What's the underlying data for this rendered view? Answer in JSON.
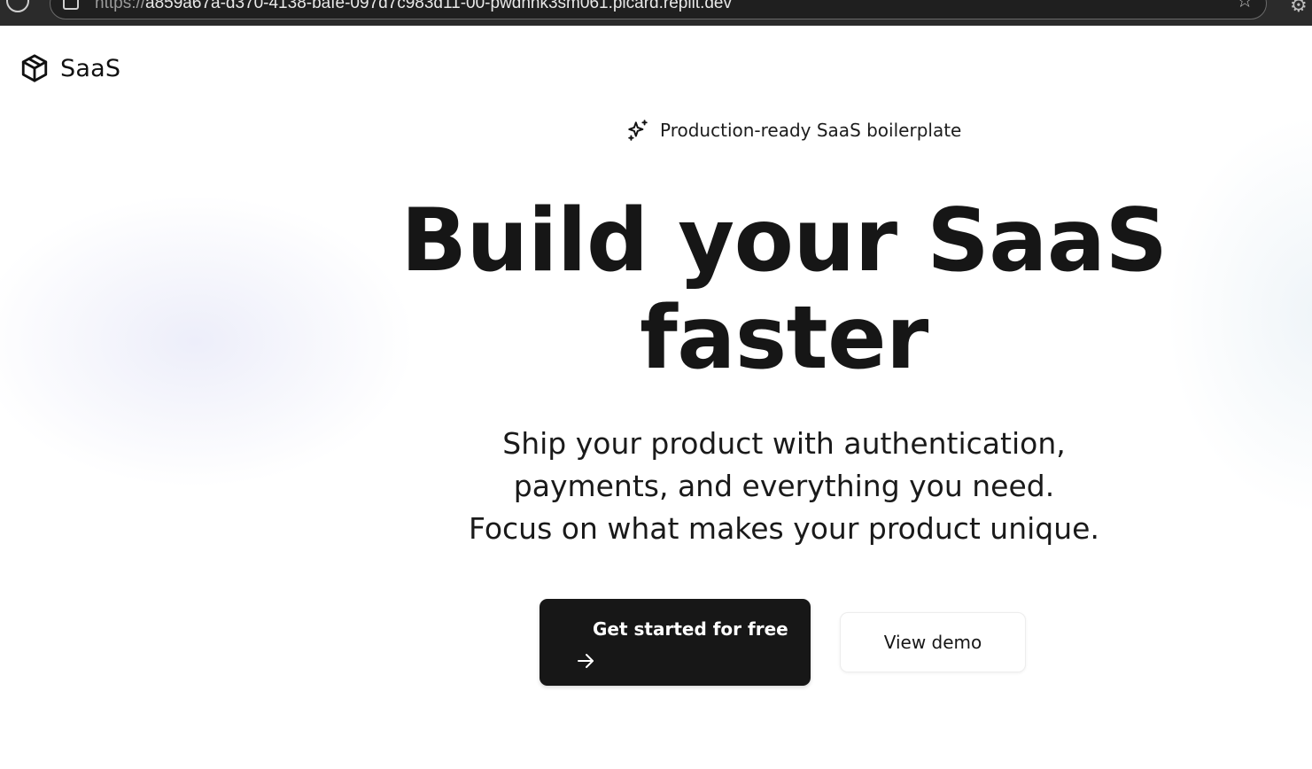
{
  "browser": {
    "url_protocol": "https://",
    "url_rest": "a859a67a-d370-4138-bafe-097d7c983d11-00-pwdhnk3sm061.picard.replit.dev"
  },
  "header": {
    "brand_name": "SaaS",
    "brand_icon": "package-icon"
  },
  "hero": {
    "tagline": "Production-ready SaaS boilerplate",
    "tagline_icon": "sparkles-icon",
    "headline_line1": "Build your SaaS",
    "headline_line2": "faster",
    "subhead_line1": "Ship your product with authentication,",
    "subhead_line2": "payments, and everything you need.",
    "subhead_line3": "Focus on what makes your product unique.",
    "primary_button": "Get started for free",
    "primary_button_icon": "arrow-right-icon",
    "secondary_button": "View demo"
  },
  "colors": {
    "primary_button_bg": "#171717",
    "text": "#161616"
  }
}
